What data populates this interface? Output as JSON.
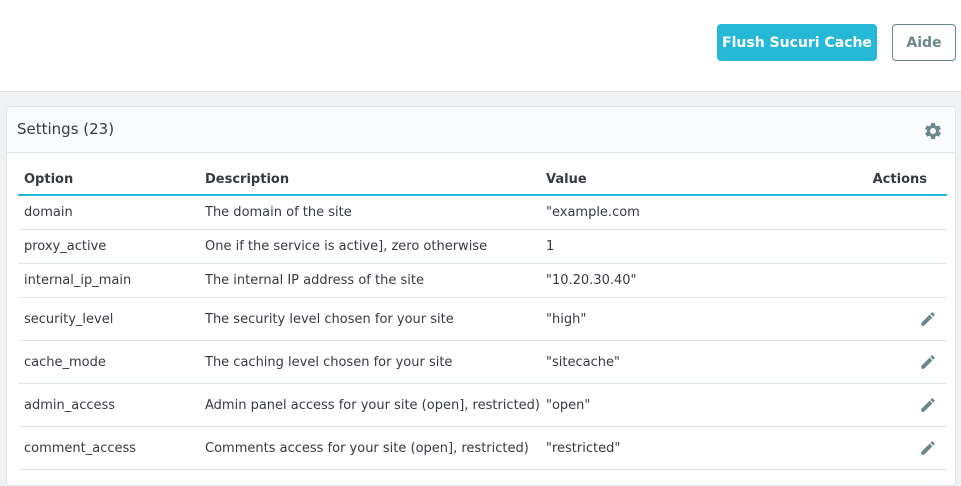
{
  "toolbar": {
    "flush_label": "Flush Sucuri Cache",
    "help_label": "Aide"
  },
  "card": {
    "title": "Settings (23)",
    "settings_icon": "gear-icon"
  },
  "table": {
    "columns": {
      "option": "Option",
      "description": "Description",
      "value": "Value",
      "actions": "Actions"
    },
    "rows": [
      {
        "option": "domain",
        "description": "The domain of the site",
        "value": "\"example.com",
        "editable": false
      },
      {
        "option": "proxy_active",
        "description": "One if the service is active], zero otherwise",
        "value": "1",
        "editable": false
      },
      {
        "option": "internal_ip_main",
        "description": "The internal IP address of the site",
        "value": "\"10.20.30.40\"",
        "editable": false
      },
      {
        "option": "security_level",
        "description": "The security level chosen for your site",
        "value": "\"high\"",
        "editable": true
      },
      {
        "option": "cache_mode",
        "description": "The caching level chosen for your site",
        "value": "\"sitecache\"",
        "editable": true
      },
      {
        "option": "admin_access",
        "description": "Admin panel access for your site (open], restricted)",
        "value": "\"open\"",
        "editable": true
      },
      {
        "option": "comment_access",
        "description": "Comments access for your site (open], restricted)",
        "value": "\"restricted\"",
        "editable": true
      }
    ]
  },
  "colors": {
    "accent": "#25b9d7",
    "text": "#363a41",
    "icon": "#6c868e"
  }
}
